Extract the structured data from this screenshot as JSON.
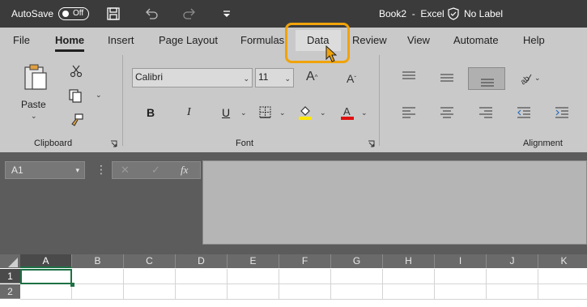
{
  "titlebar": {
    "autosave_label": "AutoSave",
    "autosave_state": "Off",
    "title": "Book2  -  Excel",
    "sensitivity": "No Label",
    "icons": [
      "save-icon",
      "undo-icon",
      "redo-icon",
      "customize-icon",
      "shield-icon"
    ]
  },
  "ribbon": {
    "tabs": [
      {
        "label": "File"
      },
      {
        "label": "Home",
        "active": true
      },
      {
        "label": "Insert"
      },
      {
        "label": "Page Layout"
      },
      {
        "label": "Formulas"
      },
      {
        "label": "Data",
        "highlighted": true
      },
      {
        "label": "Review"
      },
      {
        "label": "View"
      },
      {
        "label": "Automate"
      },
      {
        "label": "Help"
      }
    ],
    "clipboard": {
      "paste_label": "Paste",
      "group_label": "Clipboard"
    },
    "font": {
      "font_name": "Calibri",
      "font_size": "11",
      "group_label": "Font"
    },
    "alignment": {
      "group_label": "Alignment"
    },
    "highlight_color": "#f0a30a"
  },
  "formula_bar": {
    "name_box": "A1",
    "cancel_symbol": "✕",
    "enter_symbol": "✓",
    "fx_label": "fx",
    "value": ""
  },
  "sheet": {
    "columns": [
      "A",
      "B",
      "C",
      "D",
      "E",
      "F",
      "G",
      "H",
      "I",
      "J",
      "K"
    ],
    "rows": [
      "1",
      "2"
    ],
    "active_cell": "A1"
  }
}
